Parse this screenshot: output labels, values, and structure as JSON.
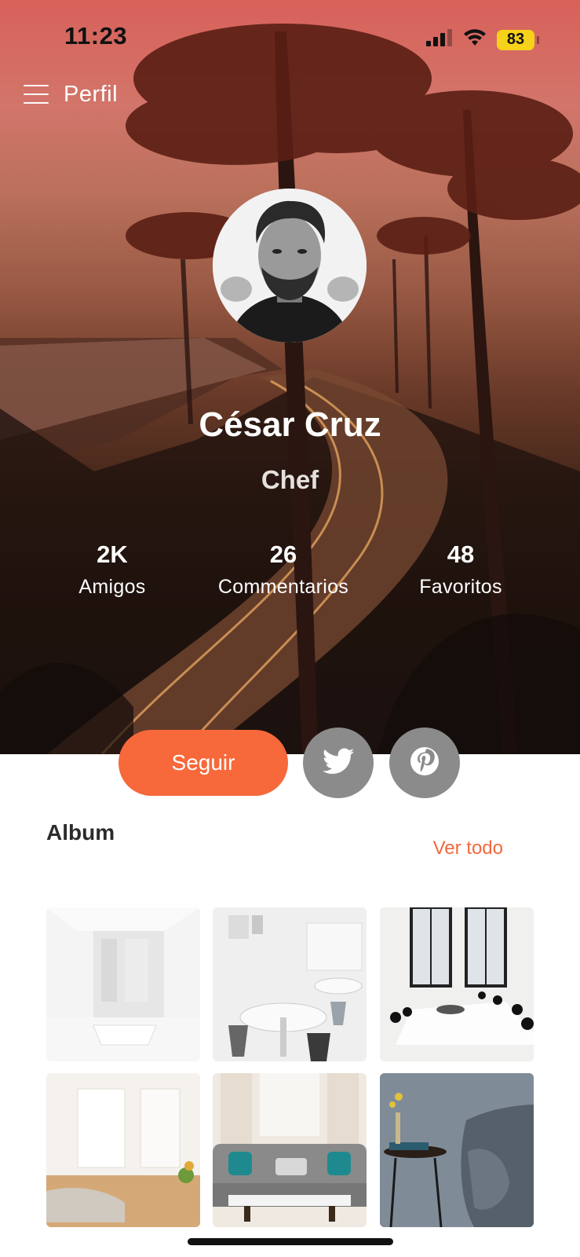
{
  "status_bar": {
    "time": "11:23",
    "battery": "83",
    "icons": [
      "signal-icon",
      "wifi-icon",
      "battery-icon"
    ]
  },
  "nav": {
    "menu_icon": "hamburger-menu-icon",
    "title": "Perfil"
  },
  "profile": {
    "name": "César Cruz",
    "role": "Chef",
    "stats": [
      {
        "value": "2K",
        "label": "Amigos"
      },
      {
        "value": "26",
        "label": "Commentarios"
      },
      {
        "value": "48",
        "label": "Favoritos"
      }
    ]
  },
  "actions": {
    "follow_label": "Seguir",
    "social_icons": [
      "twitter-icon",
      "pinterest-icon"
    ]
  },
  "album": {
    "title": "Album",
    "see_all": "Ver todo",
    "photo_count": 6
  },
  "colors": {
    "accent": "#f7683a",
    "link": "#f1693c",
    "social_button": "#8b8b8b",
    "text_dark": "#2b2b2b"
  }
}
